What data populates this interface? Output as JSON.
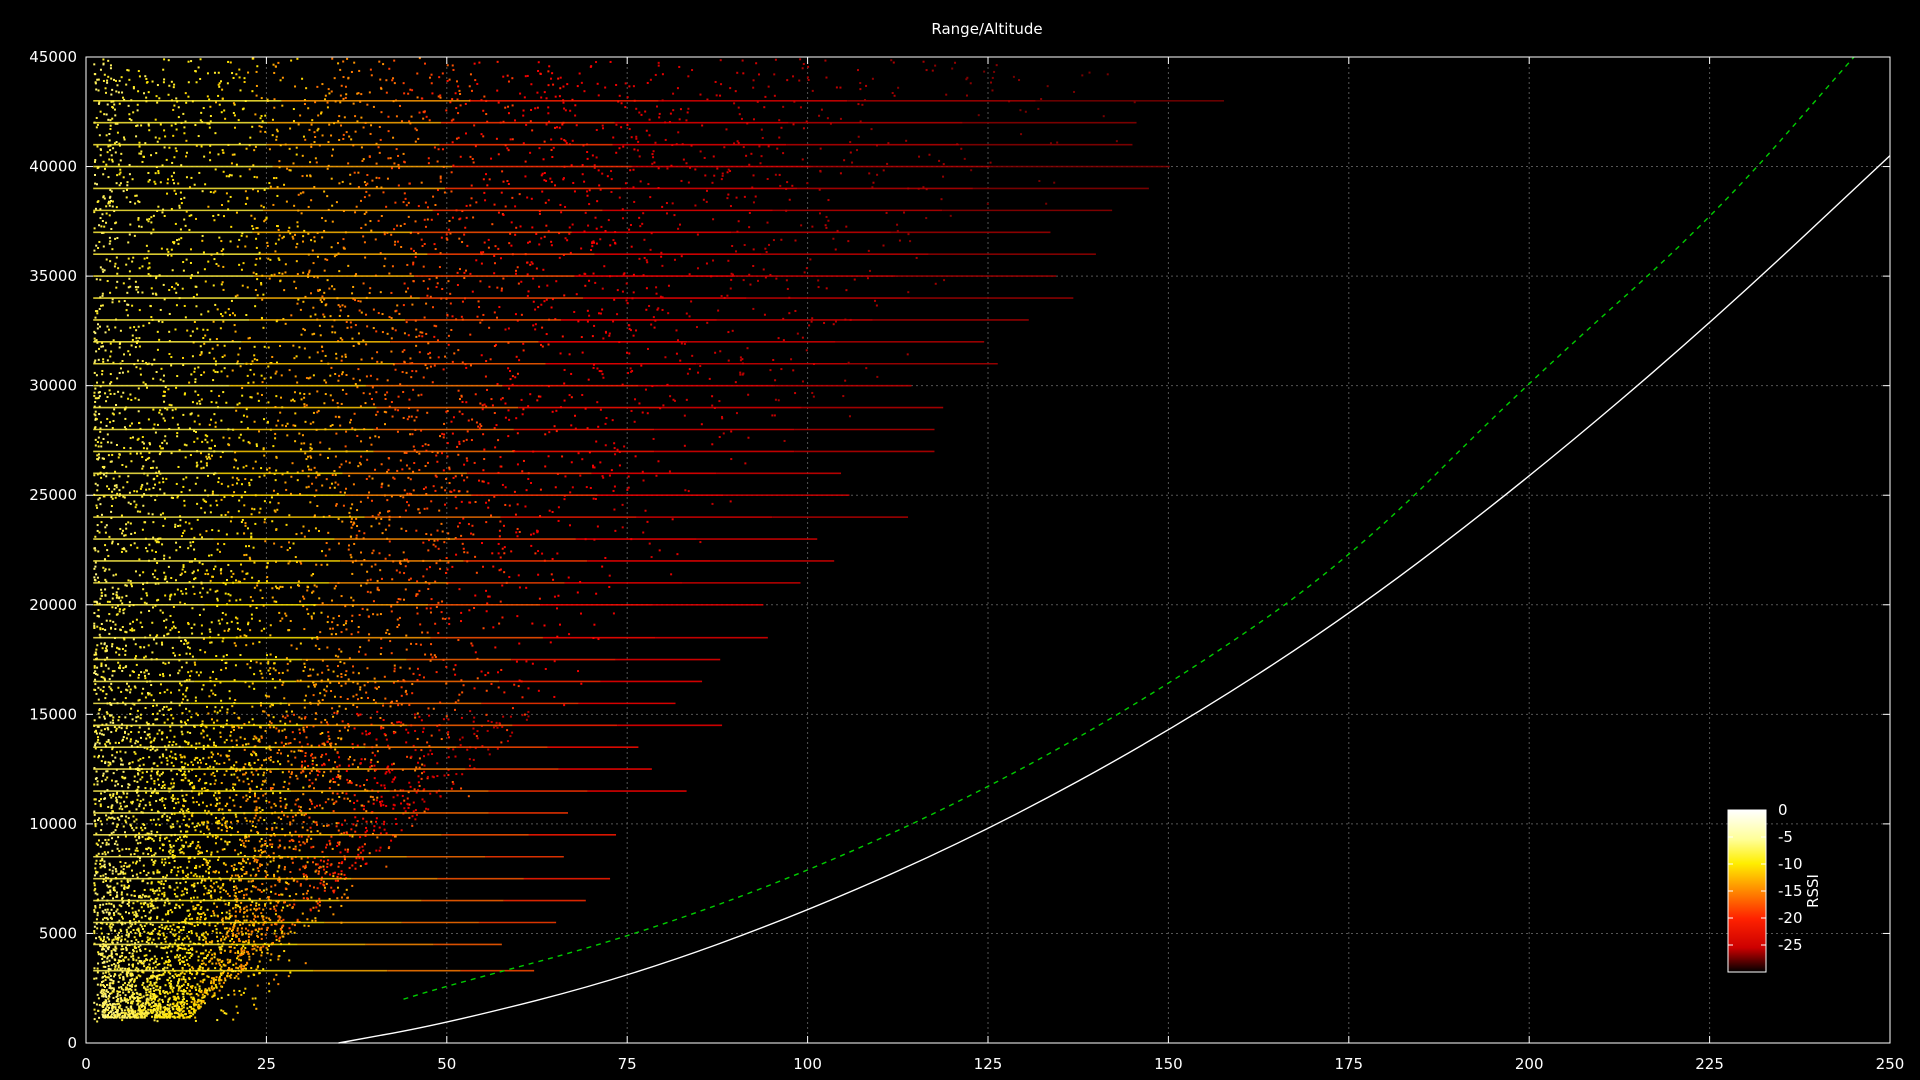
{
  "chart_data": {
    "type": "scatter",
    "title": "Range/Altitude",
    "xlabel": "",
    "ylabel": "",
    "xlim": [
      0,
      250
    ],
    "ylim": [
      0,
      45000
    ],
    "x_ticks": [
      0,
      25,
      50,
      75,
      100,
      125,
      150,
      175,
      200,
      225,
      250
    ],
    "y_ticks": [
      0,
      5000,
      10000,
      15000,
      20000,
      25000,
      30000,
      35000,
      40000,
      45000
    ],
    "grid": true,
    "colorbar": {
      "label": "RSSI",
      "range": [
        -30,
        0
      ],
      "ticks": [
        0,
        -5,
        -10,
        -15,
        -20,
        -25
      ],
      "position": "bottom-right",
      "colors": [
        "#ffffff",
        "#ffff00",
        "#ff8800",
        "#ff0000",
        "#000000"
      ]
    },
    "series": [
      {
        "style": "scatter-density",
        "color_by": "RSSI",
        "flight_levels": [
          3300,
          4500,
          5500,
          6500,
          7500,
          8500,
          9500,
          10500,
          11500,
          12500,
          13500,
          14500,
          15500,
          16500,
          17500,
          18500,
          20000,
          21000,
          22000,
          23000,
          24000,
          25000,
          26000,
          27000,
          28000,
          29000,
          30000,
          31000,
          32000,
          33000,
          34000,
          35000,
          36000,
          37000,
          38000,
          39000,
          40000,
          41000,
          42000,
          43000
        ]
      },
      {
        "style": "dashed",
        "color": "#00cc00",
        "points": [
          [
            44,
            2000
          ],
          [
            50,
            2600
          ],
          [
            75,
            4800
          ],
          [
            100,
            7800
          ],
          [
            125,
            11600
          ],
          [
            150,
            16300
          ],
          [
            175,
            22000
          ],
          [
            200,
            30200
          ],
          [
            225,
            37500
          ],
          [
            245,
            45000
          ]
        ]
      },
      {
        "style": "solid",
        "color": "#ffffff",
        "points": [
          [
            35,
            0
          ],
          [
            50,
            900
          ],
          [
            75,
            3000
          ],
          [
            100,
            6000
          ],
          [
            125,
            9700
          ],
          [
            150,
            14200
          ],
          [
            175,
            19500
          ],
          [
            200,
            25800
          ],
          [
            225,
            32800
          ],
          [
            250,
            40500
          ]
        ]
      }
    ]
  }
}
